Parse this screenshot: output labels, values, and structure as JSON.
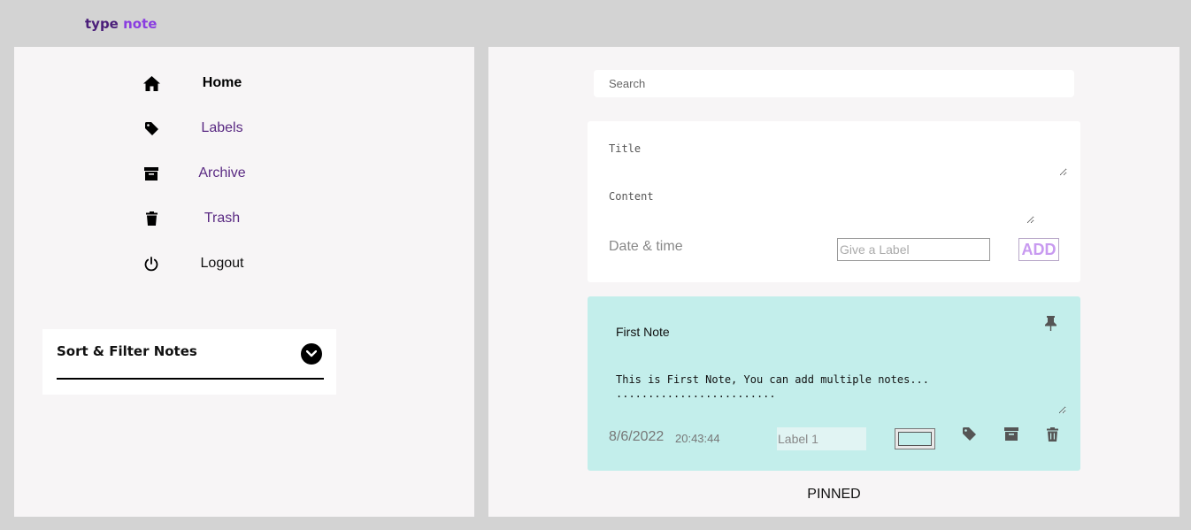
{
  "brand": {
    "part1": "type",
    "part2": "note"
  },
  "sidebar": {
    "items": [
      {
        "label": "Home",
        "icon": "home-icon"
      },
      {
        "label": "Labels",
        "icon": "tag-icon"
      },
      {
        "label": "Archive",
        "icon": "archive-icon"
      },
      {
        "label": "Trash",
        "icon": "trash-icon"
      },
      {
        "label": "Logout",
        "icon": "power-icon"
      }
    ],
    "sort_filter": {
      "title": "Sort & Filter Notes",
      "icon": "chevron-down-icon"
    }
  },
  "search": {
    "placeholder": "Search",
    "value": ""
  },
  "note_form": {
    "title_placeholder": "Title",
    "content_placeholder": "Content",
    "date_label": "Date & time",
    "label_placeholder": "Give a Label",
    "add_label": "ADD"
  },
  "note": {
    "title": "First Note",
    "content": "This is First Note, You can add multiple notes...\n.........................",
    "date": "8/6/2022",
    "time": "20:43:44",
    "label_value": "Label 1",
    "color": "#c3eeeb"
  },
  "section_label": "PINNED",
  "colors": {
    "background": "#d3d3d3",
    "panel": "#f7f5f6",
    "brand_dark": "#4b1f7a",
    "brand_accent": "#8a3ee0",
    "nav_text": "#5a2a83",
    "add_button": "#c89af0",
    "note_card": "#c3eeeb"
  }
}
